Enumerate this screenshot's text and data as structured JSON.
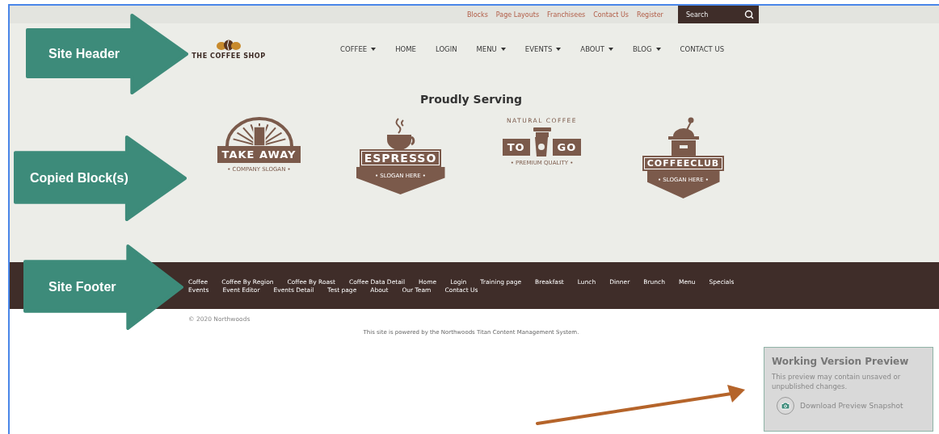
{
  "utility_links": [
    {
      "label": "Blocks"
    },
    {
      "label": "Page Layouts"
    },
    {
      "label": "Franchisees"
    },
    {
      "label": "Contact Us"
    },
    {
      "label": "Register"
    }
  ],
  "search": {
    "placeholder": "Search"
  },
  "brand": {
    "name": "THE COFFEE SHOP"
  },
  "nav": [
    {
      "label": "COFFEE",
      "dropdown": true
    },
    {
      "label": "HOME",
      "dropdown": false
    },
    {
      "label": "LOGIN",
      "dropdown": false
    },
    {
      "label": "MENU",
      "dropdown": true
    },
    {
      "label": "EVENTS",
      "dropdown": true
    },
    {
      "label": "ABOUT",
      "dropdown": true
    },
    {
      "label": "BLOG",
      "dropdown": true
    },
    {
      "label": "CONTACT US",
      "dropdown": false
    }
  ],
  "section_title": "Proudly Serving",
  "logos": [
    {
      "kind": "takeaway",
      "title": "TAKE AWAY",
      "slogan": "• COMPANY SLOGAN •"
    },
    {
      "kind": "espresso",
      "title": "ESPRESSO",
      "slogan": "• SLOGAN HERE •"
    },
    {
      "kind": "togo",
      "arc": "NATURAL COFFEE",
      "title": "TO",
      "title_2": "GO",
      "slogan": "• PREMIUM QUALITY •"
    },
    {
      "kind": "club",
      "title": "COFFEECLUB",
      "slogan": "• SLOGAN HERE •"
    }
  ],
  "footer_links": [
    [
      "Coffee",
      "Coffee By Region",
      "Coffee By Roast",
      "Coffee Data Detail",
      "Home",
      "Login",
      "Training page",
      "Breakfast",
      "Lunch",
      "Dinner",
      "Brunch",
      "Menu",
      "Specials"
    ],
    [
      "Events",
      "Event Editor",
      "Events Detail",
      "Test page",
      "About",
      "Our Team",
      "Contact Us"
    ]
  ],
  "copyright": "© 2020 Northwoods",
  "powered_by": "This site is powered by the Northwoods Titan Content Management System.",
  "preview_panel": {
    "title": "Working Version Preview",
    "text": "This preview may contain unsaved or unpublished changes.",
    "action": "Download Preview Snapshot"
  },
  "callouts": [
    {
      "label": "Site Header"
    },
    {
      "label": "Copied Block(s)"
    },
    {
      "label": "Site Footer"
    }
  ]
}
